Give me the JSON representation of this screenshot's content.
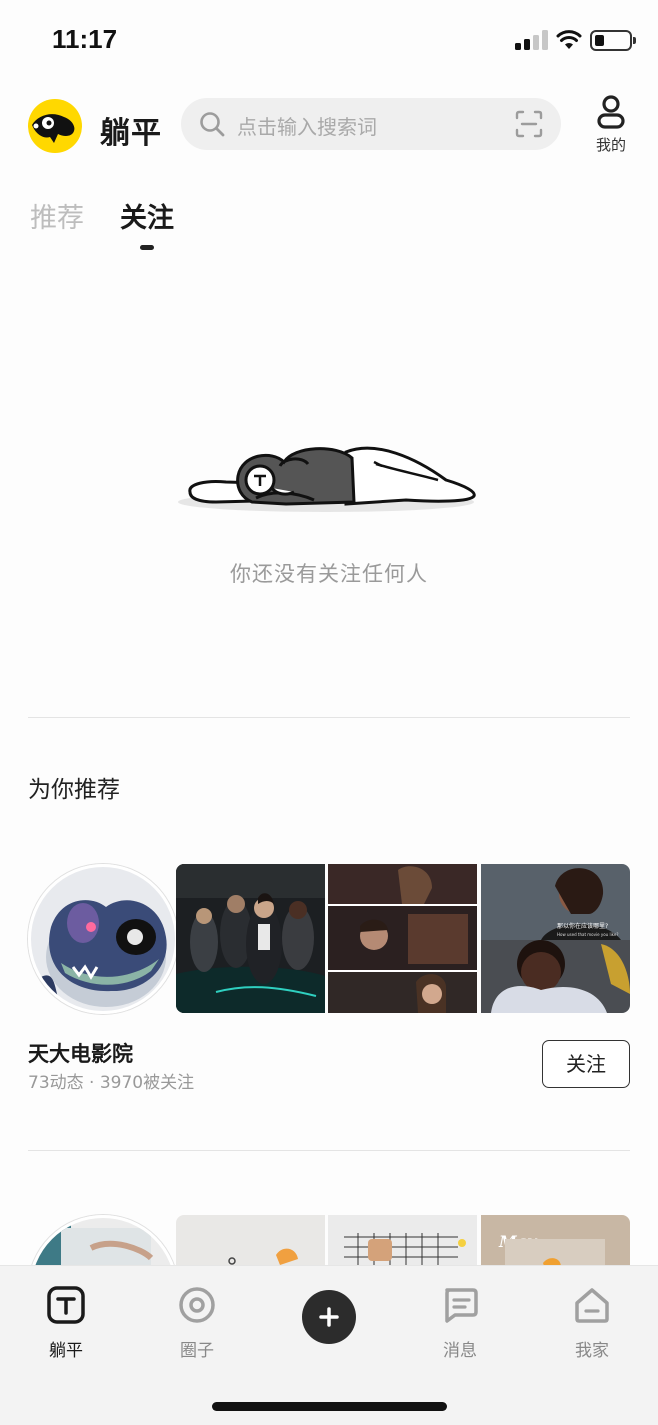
{
  "status_bar": {
    "time": "11:17",
    "signal_bars": 2,
    "battery_level": 0.22
  },
  "header": {
    "brand": "躺平",
    "search_placeholder": "点击输入搜索词",
    "mine_label": "我的"
  },
  "tabs": [
    {
      "label": "推荐",
      "active": false
    },
    {
      "label": "关注",
      "active": true
    }
  ],
  "empty_state": {
    "message": "你还没有关注任何人"
  },
  "recommend": {
    "title": "为你推荐",
    "cards": [
      {
        "name": "天大电影院",
        "meta": "73动态 · 3970被关注",
        "follow_label": "关注",
        "subtitles": [
          "那以你在应该哪里?",
          "How used that movie you like?"
        ]
      },
      {
        "photo_text": "May."
      }
    ]
  },
  "bottom_nav": [
    {
      "label": "躺平",
      "icon": "tangping-icon",
      "active": true
    },
    {
      "label": "圈子",
      "icon": "circle-target-icon",
      "active": false
    },
    {
      "label": "",
      "icon": "plus-icon",
      "active": false
    },
    {
      "label": "消息",
      "icon": "message-icon",
      "active": false
    },
    {
      "label": "我家",
      "icon": "house-icon",
      "active": false
    }
  ],
  "colors": {
    "brand_yellow": "#ffd800",
    "active_text": "#1a1a1a",
    "inactive_text": "#bdbdbd"
  }
}
